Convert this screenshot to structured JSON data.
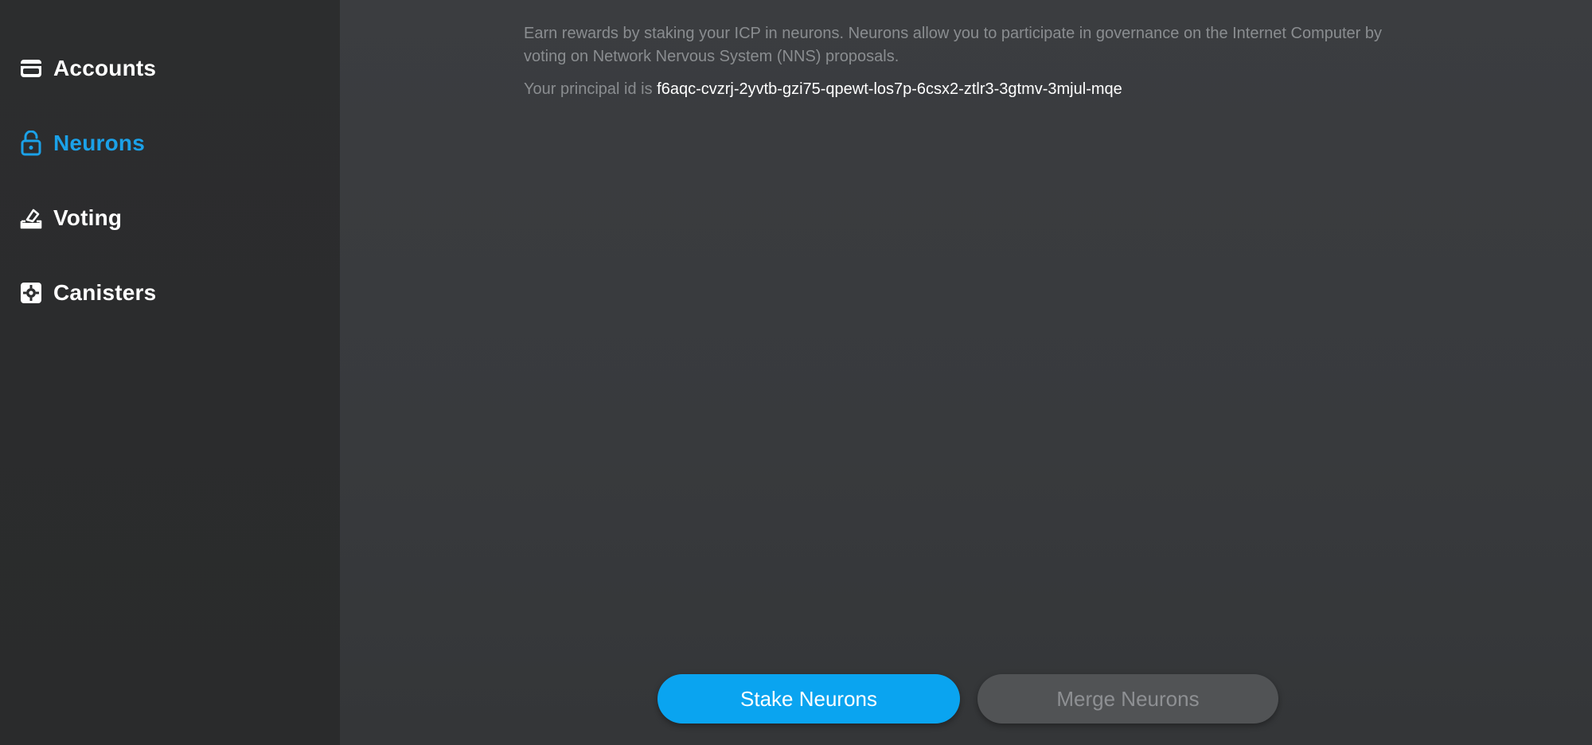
{
  "sidebar": {
    "items": [
      {
        "label": "Accounts",
        "icon": "wallet-icon",
        "active": false
      },
      {
        "label": "Neurons",
        "icon": "unlock-icon",
        "active": true
      },
      {
        "label": "Voting",
        "icon": "ballot-box-icon",
        "active": false
      },
      {
        "label": "Canisters",
        "icon": "canister-icon",
        "active": false
      }
    ]
  },
  "main": {
    "intro_text": "Earn rewards by staking your ICP in neurons. Neurons allow you to participate in governance on the Internet Computer by voting on Network Nervous System (NNS) proposals.",
    "principal_prefix": "Your principal id is",
    "principal_id": "f6aqc-cvzrj-2yvtb-gzi75-qpewt-los7p-6csx2-ztlr3-3gtmv-3mjul-mqe",
    "buttons": {
      "stake_label": "Stake Neurons",
      "merge_label": "Merge Neurons"
    }
  },
  "colors": {
    "accent": "#0aa4f0",
    "active_nav": "#1ba1e8",
    "sidebar_bg": "#2c2d2e",
    "main_bg": "#3a3d40",
    "disabled_button": "#515355"
  }
}
